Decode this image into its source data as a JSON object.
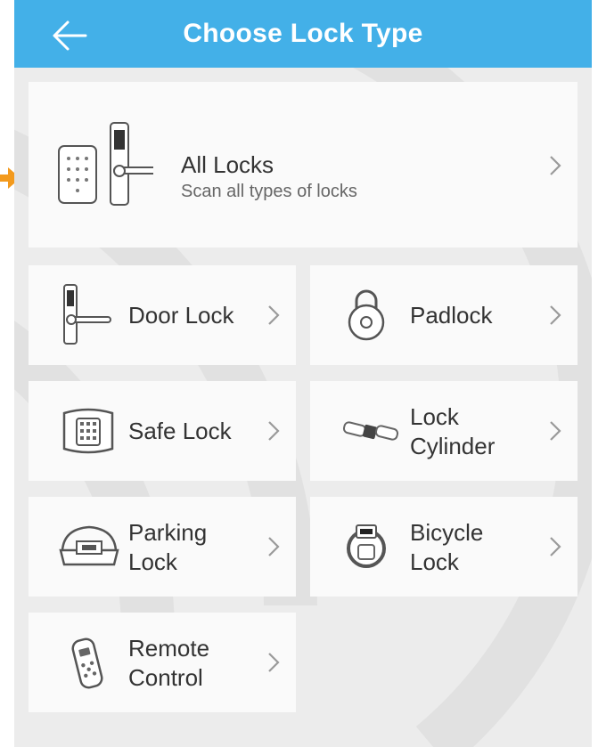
{
  "header": {
    "title": "Choose Lock Type",
    "background": "#43b0e8"
  },
  "all_locks": {
    "title": "All Locks",
    "subtitle": "Scan all types of locks"
  },
  "items": [
    {
      "line1": "Door Lock",
      "line2": "",
      "icon": "door-lock-icon"
    },
    {
      "line1": "Padlock",
      "line2": "",
      "icon": "padlock-icon"
    },
    {
      "line1": "Safe Lock",
      "line2": "",
      "icon": "safe-lock-icon"
    },
    {
      "line1": "Lock",
      "line2": "Cylinder",
      "icon": "lock-cylinder-icon"
    },
    {
      "line1": "Parking",
      "line2": "Lock",
      "icon": "parking-lock-icon"
    },
    {
      "line1": "Bicycle",
      "line2": "Lock",
      "icon": "bicycle-lock-icon"
    },
    {
      "line1": "Remote",
      "line2": "Control",
      "icon": "remote-control-icon"
    }
  ],
  "pointer_color": "#f39a1d"
}
